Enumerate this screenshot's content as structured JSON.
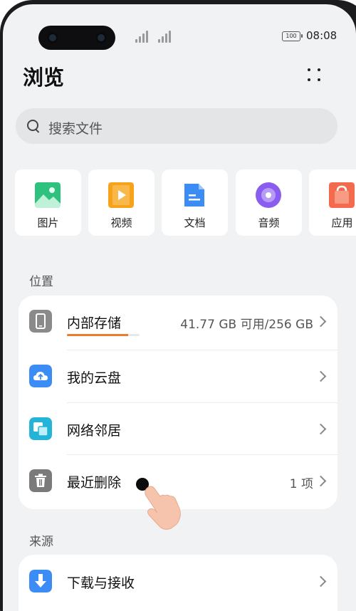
{
  "status_bar": {
    "battery": "100",
    "time": "08:08"
  },
  "header": {
    "title": "浏览"
  },
  "search": {
    "placeholder": "搜索文件"
  },
  "categories": [
    {
      "label": "图片",
      "icon": "image-icon",
      "color": "#2ec27e"
    },
    {
      "label": "视频",
      "icon": "video-icon",
      "color": "#f7a21b"
    },
    {
      "label": "文档",
      "icon": "document-icon",
      "color": "#3b8cf5"
    },
    {
      "label": "音频",
      "icon": "audio-icon",
      "color": "#8a5cf0"
    },
    {
      "label": "应用",
      "icon": "app-icon",
      "color": "#f36a4f"
    }
  ],
  "sections": {
    "location": "位置",
    "source": "来源"
  },
  "locations": [
    {
      "label": "内部存储",
      "value": "41.77 GB 可用/256 GB",
      "icon": "phone-icon",
      "color": "#8a8a8a",
      "progress": 0.84
    },
    {
      "label": "我的云盘",
      "value": "",
      "icon": "cloud-icon",
      "color": "#3b8cf5"
    },
    {
      "label": "网络邻居",
      "value": "",
      "icon": "network-icon",
      "color": "#23b4d7"
    },
    {
      "label": "最近删除",
      "value": "1 项",
      "icon": "trash-icon",
      "color": "#7a7a7a"
    }
  ],
  "sources": [
    {
      "label": "下载与接收",
      "icon": "download-icon",
      "color": "#3b8cf5"
    }
  ]
}
